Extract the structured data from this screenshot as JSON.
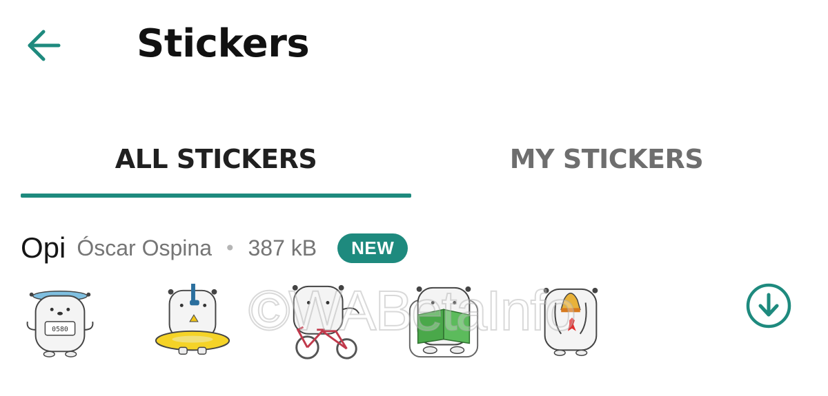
{
  "header": {
    "title": "Stickers",
    "back_icon": "arrow-left-icon"
  },
  "tabs": [
    {
      "label": "ALL STICKERS",
      "selected": true
    },
    {
      "label": "MY STICKERS",
      "selected": false
    }
  ],
  "pack": {
    "name": "Opi",
    "author": "Óscar Ospina",
    "separator": "•",
    "size": "387 kB",
    "badge": "NEW",
    "stickers": [
      {
        "name": "bear-with-scale"
      },
      {
        "name": "bear-snorkel-float"
      },
      {
        "name": "bear-bicycle"
      },
      {
        "name": "bear-reading-book"
      },
      {
        "name": "bear-bell-ears"
      }
    ],
    "download_icon": "download-circle-icon"
  },
  "watermark": "©WABetaInfo",
  "colors": {
    "accent": "#1e8a7e",
    "tab_inactive": "#6e6e6e",
    "secondary_text": "#757575"
  }
}
